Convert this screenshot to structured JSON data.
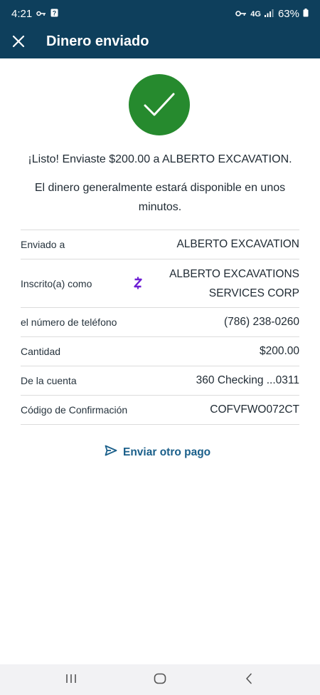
{
  "status_bar": {
    "time": "4:21",
    "network": "4G",
    "battery": "63%"
  },
  "app_bar": {
    "title": "Dinero enviado"
  },
  "confirmation": {
    "main_message": "¡Listo! Enviaste $200.00 a ALBERTO EXCAVATION.",
    "sub_message": "El dinero generalmente estará disponible en unos minutos."
  },
  "details": {
    "sent_to": {
      "label": "Enviado a",
      "value": "ALBERTO EXCAVATION"
    },
    "enrolled_as": {
      "label": "Inscrito(a) como",
      "value_line1": "ALBERTO EXCAVATIONS",
      "value_line2": "SERVICES CORP"
    },
    "phone": {
      "label": "el número de teléfono",
      "value": "(786) 238-0260"
    },
    "amount": {
      "label": "Cantidad",
      "value": "$200.00"
    },
    "from_account": {
      "label": "De la cuenta",
      "value": "360 Checking ...0311"
    },
    "confirmation_code": {
      "label": "Código de Confirmación",
      "value": "COFVFWO072CT"
    }
  },
  "actions": {
    "send_another_label": "Enviar otro pago"
  },
  "colors": {
    "header": "#0e3f5c",
    "success": "#268a2e",
    "link": "#1a5f8a",
    "zelle": "#6d1ed4"
  }
}
